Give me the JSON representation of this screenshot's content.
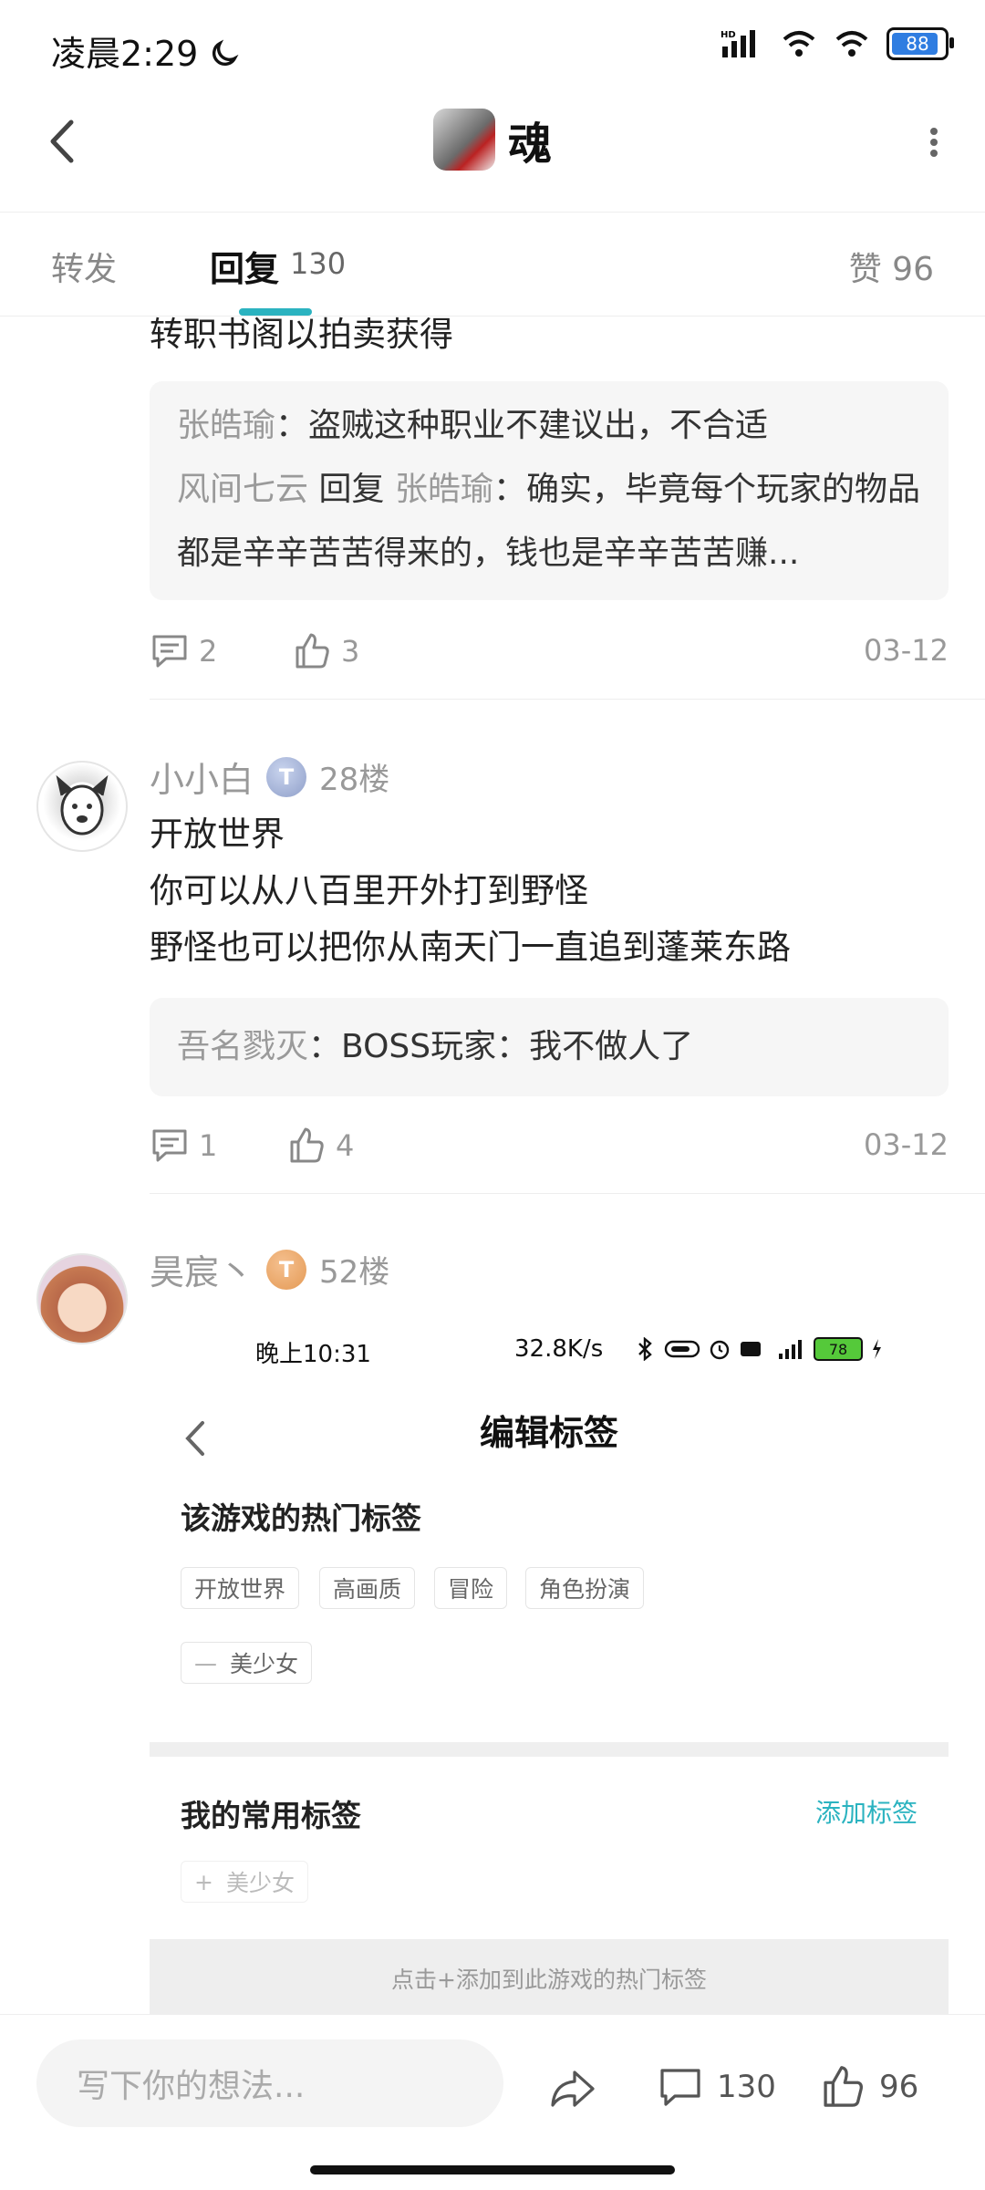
{
  "status_bar": {
    "time": "凌晨2:29",
    "battery": "88"
  },
  "header": {
    "title": "魂"
  },
  "tabs": {
    "repost": "转发",
    "reply": "回复",
    "reply_count": "130",
    "like": "赞 96"
  },
  "replies": [
    {
      "partial_text": "转职书阁以拍卖获得",
      "sub_replies": [
        {
          "name": "张皓瑜",
          "text": "：盗贼这种职业不建议出，不合适"
        },
        {
          "name": "风间七云",
          "reply_word": "回复",
          "reply_to": "张皓瑜",
          "text": "：确实，毕竟每个玩家的物品都是辛辛苦苦得来的，钱也是辛辛苦苦赚..."
        }
      ],
      "comment_count": "2",
      "like_count": "3",
      "date": "03-12"
    },
    {
      "username": "小小白",
      "badge": "T",
      "floor": "28楼",
      "lines": [
        "开放世界",
        "你可以从八百里开外打到野怪",
        "野怪也可以把你从南天门一直追到蓬莱东路"
      ],
      "sub_replies": [
        {
          "name": "吾名戮灭",
          "text": "：BOSS玩家：我不做人了"
        }
      ],
      "comment_count": "1",
      "like_count": "4",
      "date": "03-12"
    },
    {
      "username": "昊宸丶",
      "badge": "T",
      "floor": "52楼",
      "image": {
        "status_time": "晚上10:31",
        "status_speed": "32.8K/s",
        "status_battery": "78",
        "title": "编辑标签",
        "hot_section": "该游戏的热门标签",
        "hot_tags": [
          "开放世界",
          "高画质",
          "冒险",
          "角色扮演"
        ],
        "selected_tag": "美少女",
        "my_section": "我的常用标签",
        "add_label": "添加标签",
        "my_tag": "美少女",
        "bottom_hint": "点击+添加到此游戏的热门标签"
      }
    }
  ],
  "bottom_bar": {
    "placeholder": "写下你的想法...",
    "comment_count": "130",
    "like_count": "96"
  }
}
